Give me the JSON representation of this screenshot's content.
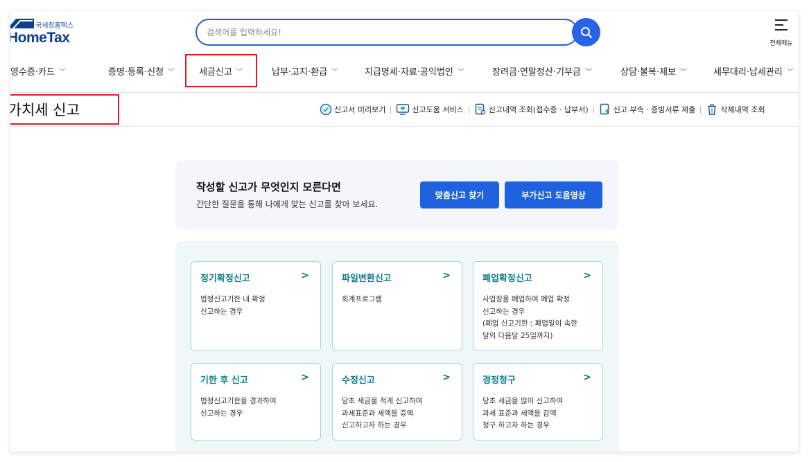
{
  "header": {
    "logo_sub": "국세청홈택스",
    "logo_main": "HomeTax",
    "search_placeholder": "검색어를 입력하세요!",
    "all_menu_label": "전체메뉴"
  },
  "nav": {
    "items": [
      {
        "label": "계산서·영수증·카드"
      },
      {
        "label": "증명·등록·신청"
      },
      {
        "label": "세금신고"
      },
      {
        "label": "납부·고지·환급"
      },
      {
        "label": "지급명세·자료·공익법인"
      },
      {
        "label": "장려금·연말정산·기부금"
      },
      {
        "label": "상담·불복·제보"
      },
      {
        "label": "세무대리·납세관리"
      }
    ],
    "active_index": 2
  },
  "page": {
    "title": "부가가치세 신고"
  },
  "utils": [
    {
      "label": "신고서 미리보기",
      "icon": "check-circle-icon"
    },
    {
      "label": "신고도움 서비스",
      "icon": "monitor-heart-icon"
    },
    {
      "label": "신고내역 조회(접수증 · 납부서)",
      "icon": "document-search-icon"
    },
    {
      "label": "신고 부속 · 증빙서류 제출",
      "icon": "document-upload-icon"
    },
    {
      "label": "삭제내역 조회",
      "icon": "trash-icon"
    }
  ],
  "banner": {
    "title": "작성할 신고가 무엇인지 모른다면",
    "subtitle": "간단한 질문을 통해 나에게 맞는 신고를 찾아 보세요.",
    "btn_find": "맞춤신고 찾기",
    "btn_video": "부가신고 도움영상"
  },
  "cards": [
    {
      "title": "정기확정신고",
      "desc": [
        "법정신고기한 내 확정",
        "신고하는 경우"
      ]
    },
    {
      "title": "파일변환신고",
      "desc": [
        "회계프로그램"
      ]
    },
    {
      "title": "폐업확정신고",
      "desc": [
        "사업장을 폐업하여 폐업 확정",
        "신고하는 경우",
        "(폐업 신고기한 : 폐업일이 속한",
        "달의 다음달 25일까지)"
      ]
    },
    {
      "title": "기한 후 신고",
      "desc": [
        "법정신고기한을 경과하여",
        "신고하는 경우"
      ]
    },
    {
      "title": "수정신고",
      "desc": [
        "당초 세금을 적게 신고하여",
        "과세표준과 세액을 증액",
        "신고하고자 하는 경우"
      ]
    },
    {
      "title": "경정청구",
      "desc": [
        "당초 세금을 많이 신고하여",
        "과세 표준과 세액을 감액",
        "청구 하고자 하는 경우"
      ]
    }
  ],
  "colors": {
    "brand_navy": "#0f3f8c",
    "accent_blue": "#1f62e0",
    "highlight_red": "#e0191e",
    "card_teal": "#0f7f8a"
  }
}
